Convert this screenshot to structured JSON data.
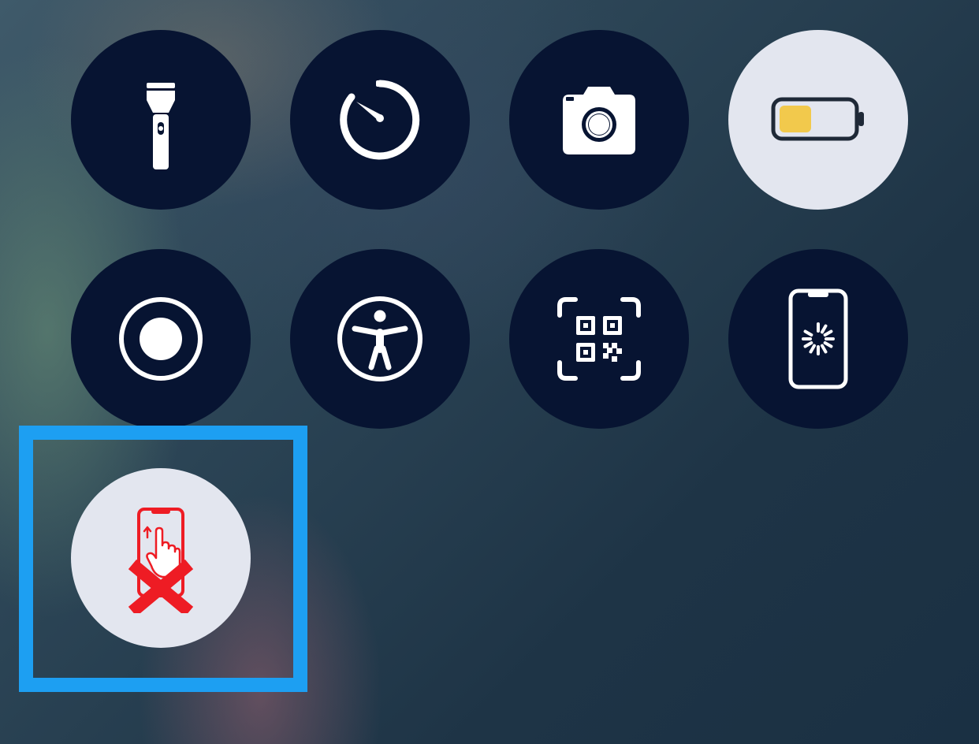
{
  "control_center": {
    "controls": [
      {
        "id": "flashlight",
        "icon": "flashlight-icon",
        "state": "off"
      },
      {
        "id": "timer",
        "icon": "timer-icon",
        "state": "off"
      },
      {
        "id": "camera",
        "icon": "camera-icon",
        "state": "off"
      },
      {
        "id": "low-power-mode",
        "icon": "battery-icon",
        "state": "on"
      },
      {
        "id": "screen-recording",
        "icon": "record-icon",
        "state": "off"
      },
      {
        "id": "accessibility-shortcut",
        "icon": "accessibility-icon",
        "state": "off"
      },
      {
        "id": "code-scanner",
        "icon": "qr-code-icon",
        "state": "off"
      },
      {
        "id": "screen-mirroring-loading",
        "icon": "iphone-spinner-icon",
        "state": "off"
      },
      {
        "id": "guided-access",
        "icon": "guided-access-icon",
        "state": "on",
        "highlighted": true
      }
    ]
  },
  "colors": {
    "control_dark_bg": "#071432",
    "control_light_bg": "#e3e6ef",
    "icon_white": "#ffffff",
    "battery_fill": "#f2c94c",
    "guided_access_red": "#ee1c24",
    "highlight_border": "#1d9ff2"
  }
}
